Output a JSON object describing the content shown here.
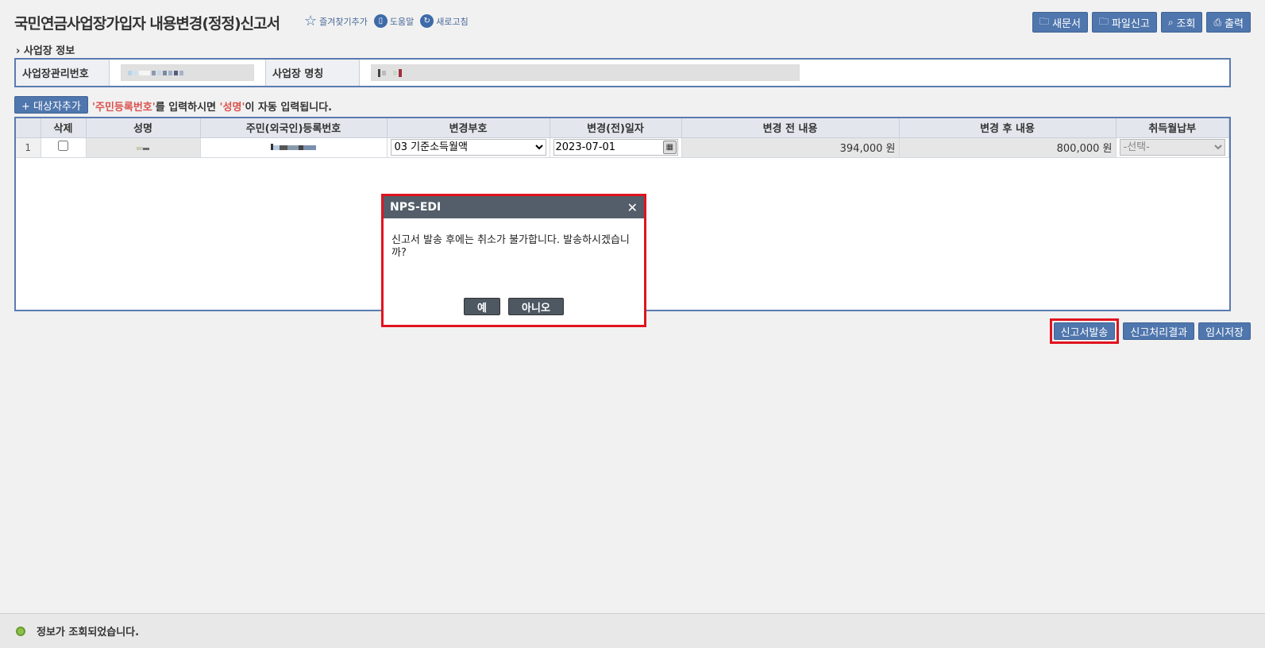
{
  "header": {
    "title": "국민연금사업장가입자 내용변경(정정)신고서",
    "links": [
      {
        "label": "즐겨찾기추가",
        "icon": "star-icon"
      },
      {
        "label": "도움말",
        "icon": "book-icon"
      },
      {
        "label": "새로고침",
        "icon": "refresh-icon"
      }
    ],
    "buttons": [
      {
        "label": "새문서",
        "icon": "folder-icon"
      },
      {
        "label": "파일신고",
        "icon": "folder-icon"
      },
      {
        "label": "조회",
        "icon": "search-icon"
      },
      {
        "label": "출력",
        "icon": "print-icon"
      }
    ]
  },
  "section": {
    "title": "› 사업장 정보",
    "mgmt_label": "사업장관리번호",
    "name_label": "사업장 명칭"
  },
  "add": {
    "button": "+ 대상자추가",
    "hint_q1": "'주민등록번호'",
    "hint_mid": "를 입력하시면 ",
    "hint_q2": "'성명'",
    "hint_end": "이 자동 입력됩니다."
  },
  "grid": {
    "columns": [
      "",
      "삭제",
      "성명",
      "주민(외국인)등록번호",
      "변경부호",
      "변경(전)일자",
      "변경 전 내용",
      "변경 후 내용",
      "취득월납부"
    ],
    "rows": [
      {
        "no": "1",
        "change_code": "03 기준소득월액",
        "date": "2023-07-01",
        "before": "394,000 원",
        "after": "800,000 원",
        "acq_select": "-선택-"
      }
    ]
  },
  "bottom_buttons": [
    "신고서발송",
    "신고처리결과",
    "임시저장"
  ],
  "dialog": {
    "title": "NPS-EDI",
    "message": "신고서 발송 후에는 취소가 불가합니다. 발송하시겠습니까?",
    "yes": "예",
    "no": "아니오"
  },
  "status": {
    "text": "정보가 조회되었습니다."
  },
  "colors": {
    "accent": "#4f76ad",
    "highlight": "#e0141f",
    "dialog_title_bg": "#545e6a"
  }
}
